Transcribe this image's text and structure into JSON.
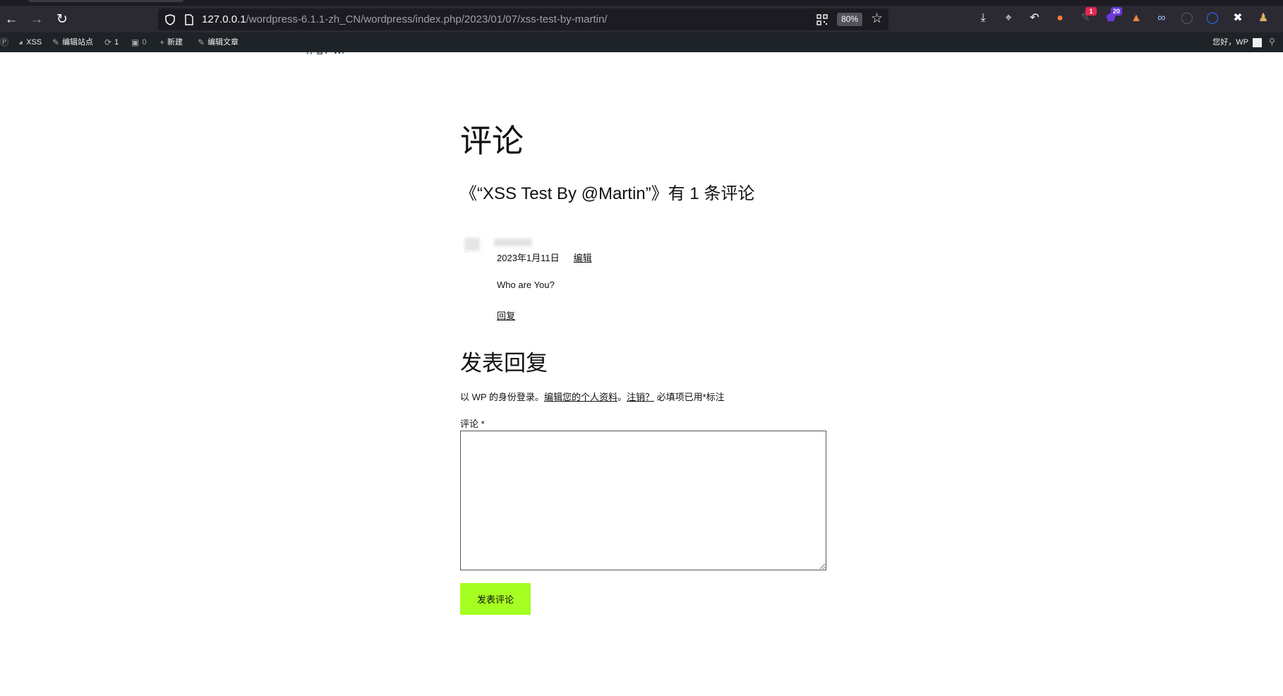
{
  "browser": {
    "url_host": "127.0.0.1",
    "url_path": "/wordpress-6.1.1-zh_CN/wordpress/index.php/2023/01/07/xss-test-by-martin/",
    "zoom": "80%",
    "ext_badge_1": "1",
    "ext_badge_2": "20",
    "colors": {
      "chrome": "#2b2a33",
      "urlbar": "#1c1b22",
      "badge_red": "#e22850",
      "badge_purple": "#6b38d9"
    }
  },
  "adminbar": {
    "site_name": "XSS",
    "edit_site": "编辑站点",
    "updates_count": "1",
    "comments_count": "0",
    "new_label": "新建",
    "edit_post": "编辑文章",
    "greeting": "您好，WP"
  },
  "post": {
    "author_cut": "作者：WP"
  },
  "comments": {
    "title": "评论",
    "count_heading": "《“XSS Test By @Martin”》有 1 条评论",
    "items": [
      {
        "date": "2023年1月11日",
        "edit": "编辑",
        "body": "Who are You?",
        "reply": "回复"
      }
    ]
  },
  "reply_form": {
    "title": "发表回复",
    "logged_in_prefix": "以 WP 的身份登录。",
    "edit_profile": "编辑您的个人资料",
    "sep": "。",
    "logout": "注销？",
    "required_note": " 必填项已用*标注",
    "comment_label": "评论 *",
    "submit": "发表评论",
    "accent": "#a5ff20"
  }
}
